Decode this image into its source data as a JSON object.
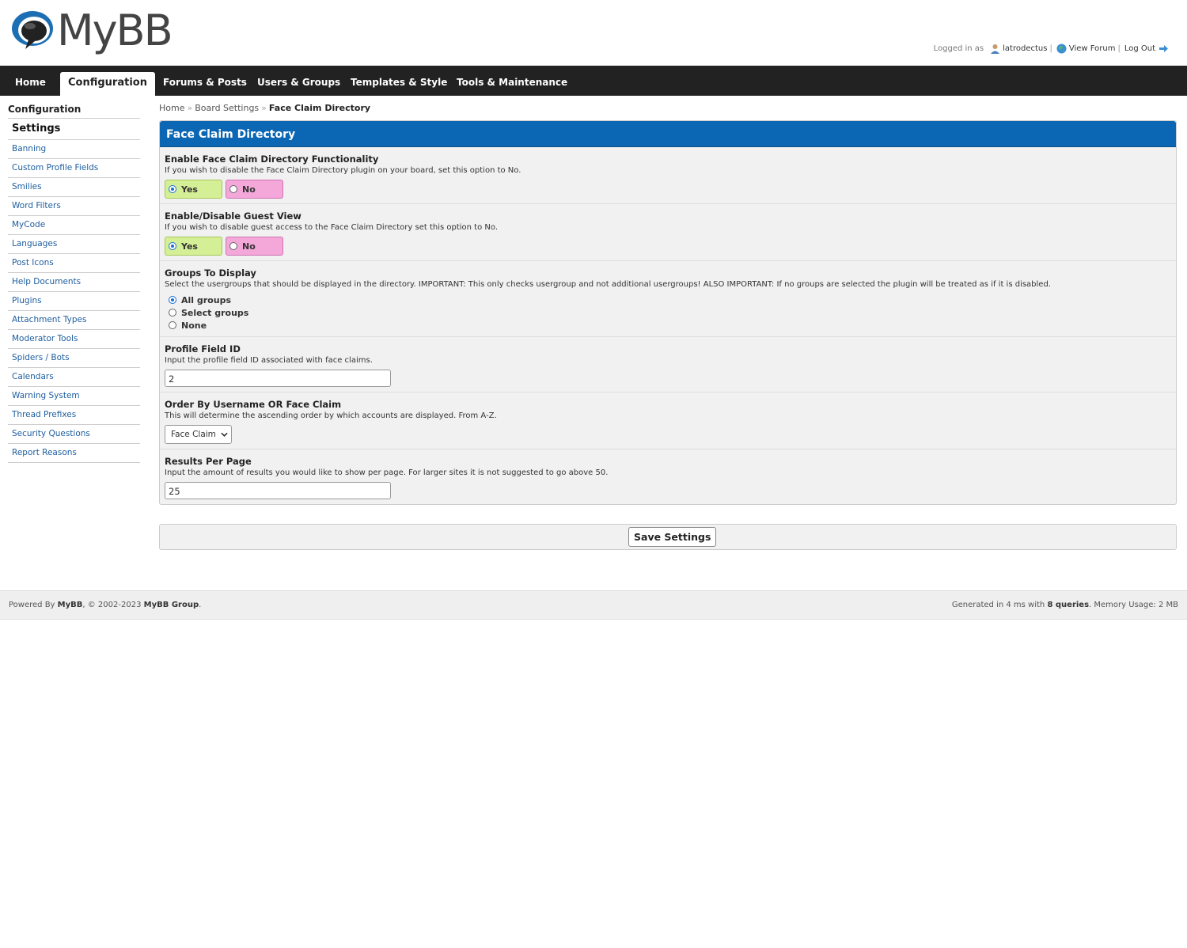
{
  "logo": {
    "text": "MyBB"
  },
  "user_bar": {
    "logged_in_label": "Logged in as",
    "username": "latrodectus",
    "view_forum": "View Forum",
    "log_out": "Log Out",
    "separator": "|"
  },
  "nav": {
    "tabs": [
      {
        "label": "Home"
      },
      {
        "label": "Configuration"
      },
      {
        "label": "Forums & Posts"
      },
      {
        "label": "Users & Groups"
      },
      {
        "label": "Templates & Style"
      },
      {
        "label": "Tools & Maintenance"
      }
    ]
  },
  "sidebar": {
    "title": "Configuration",
    "current": "Settings",
    "items": [
      "Banning",
      "Custom Profile Fields",
      "Smilies",
      "Word Filters",
      "MyCode",
      "Languages",
      "Post Icons",
      "Help Documents",
      "Plugins",
      "Attachment Types",
      "Moderator Tools",
      "Spiders / Bots",
      "Calendars",
      "Warning System",
      "Thread Prefixes",
      "Security Questions",
      "Report Reasons"
    ]
  },
  "breadcrumb": {
    "home": "Home",
    "board": "Board Settings",
    "current": "Face Claim Directory",
    "sep": "»"
  },
  "panel": {
    "title": "Face Claim Directory",
    "settings": {
      "enable": {
        "label": "Enable Face Claim Directory Functionality",
        "desc": "If you wish to disable the Face Claim Directory plugin on your board, set this option to No.",
        "yes": "Yes",
        "no": "No"
      },
      "guest": {
        "label": "Enable/Disable Guest View",
        "desc": "If you wish to disable guest access to the Face Claim Directory set this option to No.",
        "yes": "Yes",
        "no": "No"
      },
      "groups": {
        "label": "Groups To Display",
        "desc": "Select the usergroups that should be displayed in the directory. IMPORTANT: This only checks usergroup and not additional usergroups! ALSO IMPORTANT: If no groups are selected the plugin will be treated as if it is disabled.",
        "options": [
          "All groups",
          "Select groups",
          "None"
        ]
      },
      "field": {
        "label": "Profile Field ID",
        "desc": "Input the profile field ID associated with face claims.",
        "value": "2"
      },
      "order": {
        "label": "Order By Username OR Face Claim",
        "desc": "This will determine the ascending order by which accounts are displayed. From A-Z.",
        "value": "Face Claim"
      },
      "results": {
        "label": "Results Per Page",
        "desc": "Input the amount of results you would like to show per page. For larger sites it is not suggested to go above 50.",
        "value": "25"
      }
    }
  },
  "save": {
    "label": "Save Settings"
  },
  "footer": {
    "powered_prefix": "Powered By",
    "mybb": "MyBB",
    "copyright": ", © 2002-2023",
    "group": "MyBB Group",
    "generated_prefix": "Generated in 4 ms with",
    "queries": "8 queries",
    "memory": ". Memory Usage: 2 MB"
  }
}
